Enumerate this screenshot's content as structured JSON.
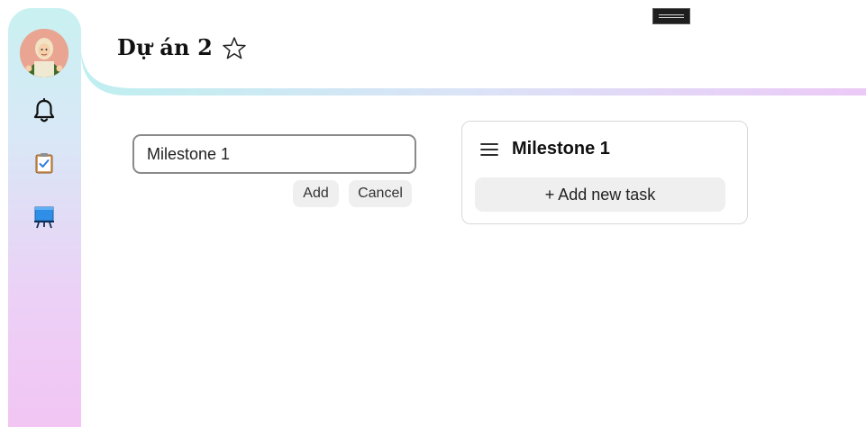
{
  "project": {
    "title": "Dự án 2"
  },
  "sidebar": {
    "items": [
      {
        "name": "notifications",
        "icon": "bell-icon"
      },
      {
        "name": "tasks",
        "icon": "clipboard-check-icon"
      },
      {
        "name": "board",
        "icon": "presentation-board-icon"
      }
    ]
  },
  "milestone_form": {
    "value": "Milestone 1",
    "add_label": "Add",
    "cancel_label": "Cancel"
  },
  "milestone_card": {
    "title": "Milestone 1",
    "add_task_label": "+ Add new task"
  },
  "colors": {
    "sidebar_gradient_top": "#c9f1f1",
    "sidebar_gradient_bottom": "#f2c5f3",
    "header_line_start": "#bfeff0",
    "header_line_end": "#ecc9f7",
    "button_bg": "#efefef"
  }
}
